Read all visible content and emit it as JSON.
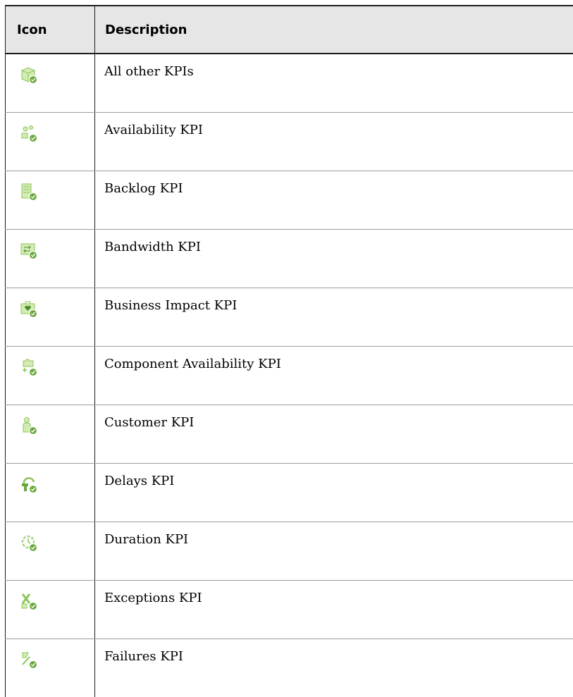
{
  "table": {
    "headers": {
      "icon": "Icon",
      "description": "Description"
    },
    "rows": [
      {
        "icon": "cube-kpi-icon",
        "description": "All other KPIs"
      },
      {
        "icon": "availability-kpi-icon",
        "description": "Availability KPI"
      },
      {
        "icon": "backlog-kpi-icon",
        "description": "Backlog KPI"
      },
      {
        "icon": "bandwidth-kpi-icon",
        "description": "Bandwidth KPI"
      },
      {
        "icon": "business-impact-kpi-icon",
        "description": "Business Impact KPI"
      },
      {
        "icon": "component-availability-kpi-icon",
        "description": "Component Availability KPI"
      },
      {
        "icon": "customer-kpi-icon",
        "description": "Customer KPI"
      },
      {
        "icon": "delays-kpi-icon",
        "description": "Delays KPI"
      },
      {
        "icon": "duration-kpi-icon",
        "description": "Duration KPI"
      },
      {
        "icon": "exceptions-kpi-icon",
        "description": "Exceptions KPI"
      },
      {
        "icon": "failures-kpi-icon",
        "description": "Failures KPI"
      }
    ]
  },
  "colors": {
    "header_bg": "#e6e6e6",
    "icon_green_light": "#d3ecb3",
    "icon_green": "#8cc45a",
    "icon_green_dark": "#4c8a2c",
    "border": "#1c1c1c"
  }
}
